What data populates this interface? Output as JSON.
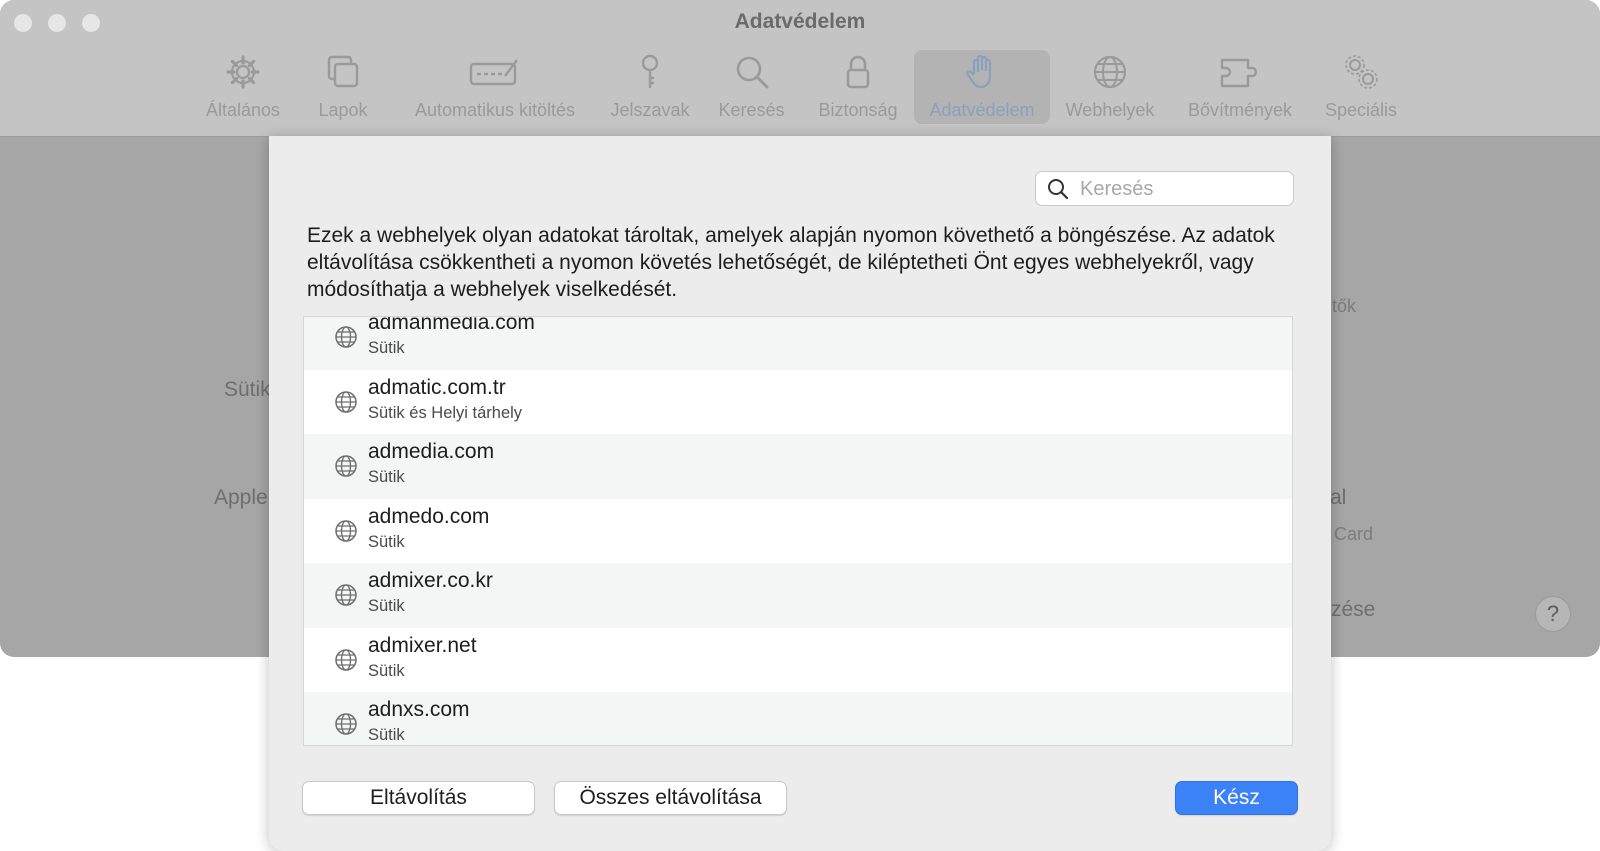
{
  "window": {
    "title": "Adatvédelem",
    "toolbar": [
      {
        "label": "Általános",
        "icon": "gear-icon"
      },
      {
        "label": "Lapok",
        "icon": "tabs-icon"
      },
      {
        "label": "Automatikus kitöltés",
        "icon": "autofill-icon"
      },
      {
        "label": "Jelszavak",
        "icon": "key-icon"
      },
      {
        "label": "Keresés",
        "icon": "search-icon"
      },
      {
        "label": "Biztonság",
        "icon": "lock-icon"
      },
      {
        "label": "Adatvédelem",
        "icon": "hand-icon",
        "active": true
      },
      {
        "label": "Webhelyek",
        "icon": "globe-icon"
      },
      {
        "label": "Bővítmények",
        "icon": "puzzle-icon"
      },
      {
        "label": "Speciális",
        "icon": "gears-icon"
      }
    ],
    "background_fragments": {
      "left_1": "Sütik",
      "left_2": "Apple",
      "right_1": "tők",
      "right_2": "al",
      "right_3": "Card",
      "right_4": "zése"
    },
    "help_label": "?"
  },
  "sheet": {
    "search": {
      "placeholder": "Keresés",
      "value": ""
    },
    "description": "Ezek a webhelyek olyan adatokat tároltak, amelyek alapján nyomon követhető a böngészése. Az adatok eltávolítása csökkentheti a nyomon követés lehetőségét, de kiléptetheti Önt egyes webhelyekről, vagy módosíthatja a webhelyek viselkedését.",
    "sites": [
      {
        "name": "admanmedia.com",
        "data": "Sütik"
      },
      {
        "name": "admatic.com.tr",
        "data": "Sütik és Helyi tárhely"
      },
      {
        "name": "admedia.com",
        "data": "Sütik"
      },
      {
        "name": "admedo.com",
        "data": "Sütik"
      },
      {
        "name": "admixer.co.kr",
        "data": "Sütik"
      },
      {
        "name": "admixer.net",
        "data": "Sütik"
      },
      {
        "name": "adnxs.com",
        "data": "Sütik"
      }
    ],
    "buttons": {
      "remove": "Eltávolítás",
      "remove_all": "Összes eltávolítása",
      "done": "Kész"
    },
    "accent_color": "#3b82f6"
  }
}
